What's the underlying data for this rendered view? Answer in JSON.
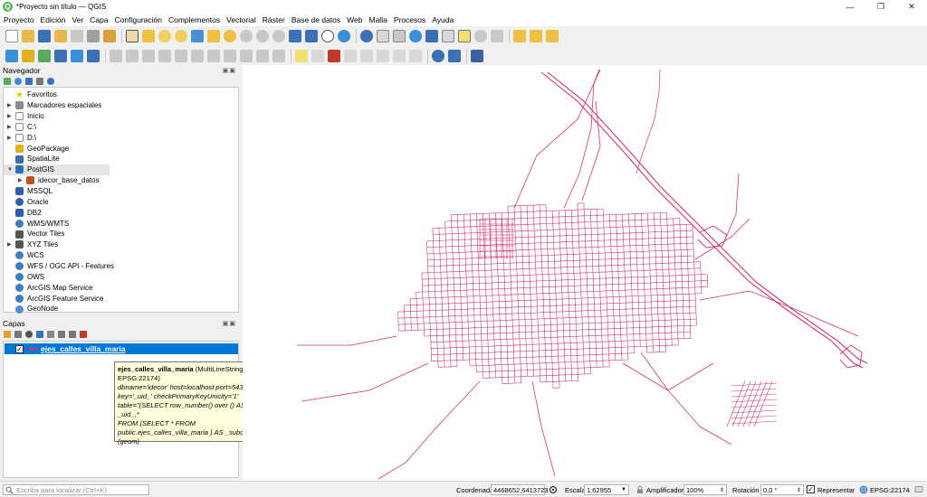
{
  "window": {
    "title": "*Proyecto sin título — QGIS",
    "controls": [
      "—",
      "❐",
      "✕"
    ]
  },
  "menu": [
    "Proyecto",
    "Edición",
    "Ver",
    "Capa",
    "Configuración",
    "Complementos",
    "Vectorial",
    "Ráster",
    "Base de datos",
    "Web",
    "Malla",
    "Procesos",
    "Ayuda"
  ],
  "browser_panel": {
    "title": "Navegador",
    "items": [
      {
        "label": "Favoritos",
        "icon": "star-icon",
        "color": "#f5c400",
        "expander": false,
        "indent": 0
      },
      {
        "label": "Marcadores espaciales",
        "icon": "bookmarks-icon",
        "color": "#8c8c8c",
        "expander": true,
        "indent": 0
      },
      {
        "label": "Inicio",
        "icon": "home-folder-icon",
        "color": "#8c8c8c",
        "expander": true,
        "indent": 0
      },
      {
        "label": "C:\\",
        "icon": "drive-folder-icon",
        "color": "#8c8c8c",
        "expander": true,
        "indent": 0
      },
      {
        "label": "D:\\",
        "icon": "drive-folder-icon",
        "color": "#8c8c8c",
        "expander": true,
        "indent": 0
      },
      {
        "label": "GeoPackage",
        "icon": "geopackage-icon",
        "color": "#e0b020",
        "expander": false,
        "indent": 0
      },
      {
        "label": "SpatiaLite",
        "icon": "spatialite-icon",
        "color": "#3a6ea8",
        "expander": false,
        "indent": 0
      },
      {
        "label": "PostGIS",
        "icon": "postgis-elephant-icon",
        "color": "#2f6db5",
        "expander": true,
        "expanded": true,
        "indent": 0
      },
      {
        "label": "idecor_base_datos",
        "icon": "db-connection-icon",
        "color": "#c05020",
        "expander": true,
        "indent": 1
      },
      {
        "label": "MSSQL",
        "icon": "mssql-icon",
        "color": "#2f5ea8",
        "expander": false,
        "indent": 0
      },
      {
        "label": "Oracle",
        "icon": "oracle-icon",
        "color": "#2f5ea8",
        "expander": false,
        "indent": 0
      },
      {
        "label": "DB2",
        "icon": "db2-icon",
        "color": "#2f5ea8",
        "expander": false,
        "indent": 0
      },
      {
        "label": "WMS/WMTS",
        "icon": "globe-icon",
        "color": "#3a7fc0",
        "expander": false,
        "indent": 0
      },
      {
        "label": "Vector Tiles",
        "icon": "vector-tiles-icon",
        "color": "#555555",
        "expander": false,
        "indent": 0
      },
      {
        "label": "XYZ Tiles",
        "icon": "xyz-tiles-icon",
        "color": "#555555",
        "expander": true,
        "indent": 0
      },
      {
        "label": "WCS",
        "icon": "globe-icon",
        "color": "#3a7fc0",
        "expander": false,
        "indent": 0
      },
      {
        "label": "WFS / OGC API - Features",
        "icon": "globe-icon",
        "color": "#3a7fc0",
        "expander": false,
        "indent": 0
      },
      {
        "label": "OWS",
        "icon": "globe-icon",
        "color": "#3a7fc0",
        "expander": false,
        "indent": 0
      },
      {
        "label": "ArcGIS Map Service",
        "icon": "globe-icon",
        "color": "#3a7fc0",
        "expander": false,
        "indent": 0
      },
      {
        "label": "ArcGIS Feature Service",
        "icon": "globe-icon",
        "color": "#3a7fc0",
        "expander": false,
        "indent": 0
      },
      {
        "label": "GeoNode",
        "icon": "geonode-icon",
        "color": "#4a8fd0",
        "expander": false,
        "indent": 0
      }
    ]
  },
  "layers_panel": {
    "title": "Capas",
    "layers": [
      {
        "name": "ejes_calles_villa_maria",
        "checked": "✓",
        "symbol_color": "#d6336c"
      }
    ]
  },
  "tooltip": {
    "title": "ejes_calles_villa_maria",
    "geom_info": " (MultiLineString - EPSG:22174)",
    "line1": "dbname='idecor' host=localhost port=5432",
    "line2": "key='_uid_' checkPrimaryKeyUnicity='1'",
    "line3": "table=\"(SELECT row_number() over () AS _uid_,*",
    "line4": "FROM (SELECT * FROM",
    "line5": "public.ejes_calles_villa_maria ) AS _subq_1_ )\"",
    "line6": "(geom)"
  },
  "map": {
    "line_color": "#d6336c"
  },
  "statusbar": {
    "locator_placeholder": "Escriba para localizar (Ctrl+K)",
    "coord_label": "Coordenada",
    "coord_value": "4468652,6413723",
    "scale_label": "Escala",
    "scale_value": "1:62955",
    "magnifier_label": "Amplificador",
    "magnifier_value": "100%",
    "rotation_label": "Rotación",
    "rotation_value": "0,0 °",
    "render_label": "Representar",
    "render_checked": "✓",
    "crs": "EPSG:22174"
  }
}
